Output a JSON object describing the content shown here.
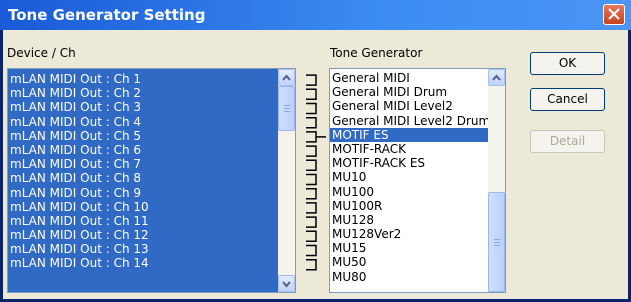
{
  "window": {
    "title": "Tone Generator Setting"
  },
  "device_list": {
    "label": "Device / Ch",
    "items": [
      "mLAN MIDI Out : Ch 1",
      "mLAN MIDI Out : Ch 2",
      "mLAN MIDI Out : Ch 3",
      "mLAN MIDI Out : Ch 4",
      "mLAN MIDI Out : Ch 5",
      "mLAN MIDI Out : Ch 6",
      "mLAN MIDI Out : Ch 7",
      "mLAN MIDI Out : Ch 8",
      "mLAN MIDI Out : Ch 9",
      "mLAN MIDI Out : Ch 10",
      "mLAN MIDI Out : Ch 11",
      "mLAN MIDI Out : Ch 12",
      "mLAN MIDI Out : Ch 13",
      "mLAN MIDI Out : Ch 14"
    ]
  },
  "tone_list": {
    "label": "Tone Generator",
    "items": [
      "General MIDI",
      "General MIDI Drum",
      "General MIDI Level2",
      "General MIDI Level2 Drum",
      "MOTIF ES",
      "MOTIF-RACK",
      "MOTIF-RACK ES",
      "MU10",
      "MU100",
      "MU100R",
      "MU128",
      "MU128Ver2",
      "MU15",
      "MU50",
      "MU80"
    ],
    "selected": "MOTIF ES"
  },
  "buttons": {
    "ok": "OK",
    "cancel": "Cancel",
    "detail": "Detail"
  },
  "colors": {
    "selection": "#316ac5",
    "title_bar": "#2a6ee0",
    "close": "#d4502f"
  }
}
